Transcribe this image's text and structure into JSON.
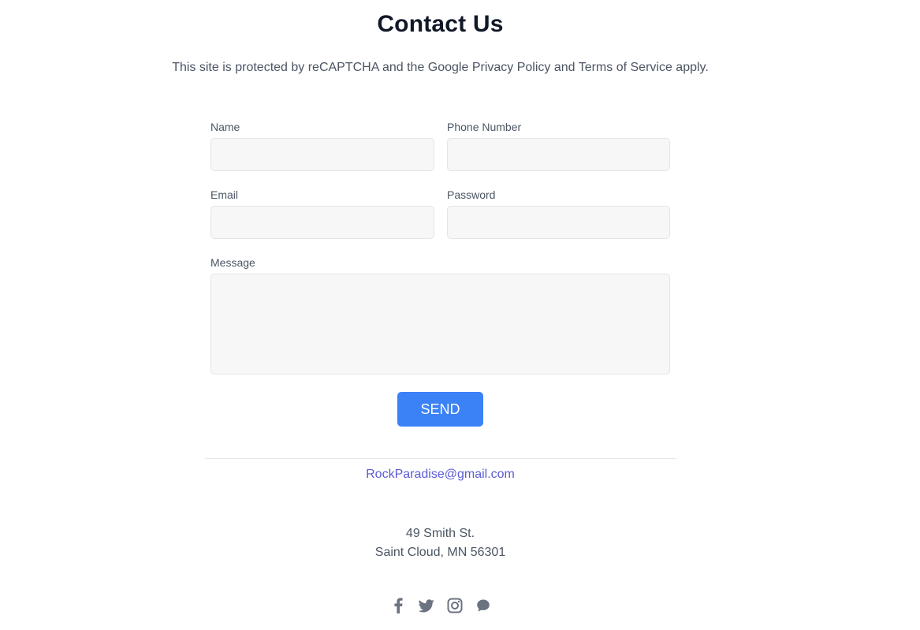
{
  "header": {
    "title": "Contact Us",
    "subtitle": "This site is protected by reCAPTCHA and the Google Privacy Policy and Terms of Service apply."
  },
  "form": {
    "name_label": "Name",
    "name_value": "",
    "phone_label": "Phone Number",
    "phone_value": "",
    "email_label": "Email",
    "email_value": "",
    "password_label": "Password",
    "password_value": "",
    "message_label": "Message",
    "message_value": "",
    "send_label": "SEND"
  },
  "footer": {
    "email": "RockParadise@gmail.com",
    "address_line1": "49 Smith St.",
    "address_line2": "Saint Cloud, MN 56301",
    "social_icons": [
      "facebook-icon",
      "twitter-icon",
      "instagram-icon",
      "chat-icon"
    ],
    "icon_color": "#6b7280"
  },
  "colors": {
    "accent": "#3b82f6",
    "link": "#5b5bd6",
    "title": "#111827",
    "text": "#4b5563"
  }
}
